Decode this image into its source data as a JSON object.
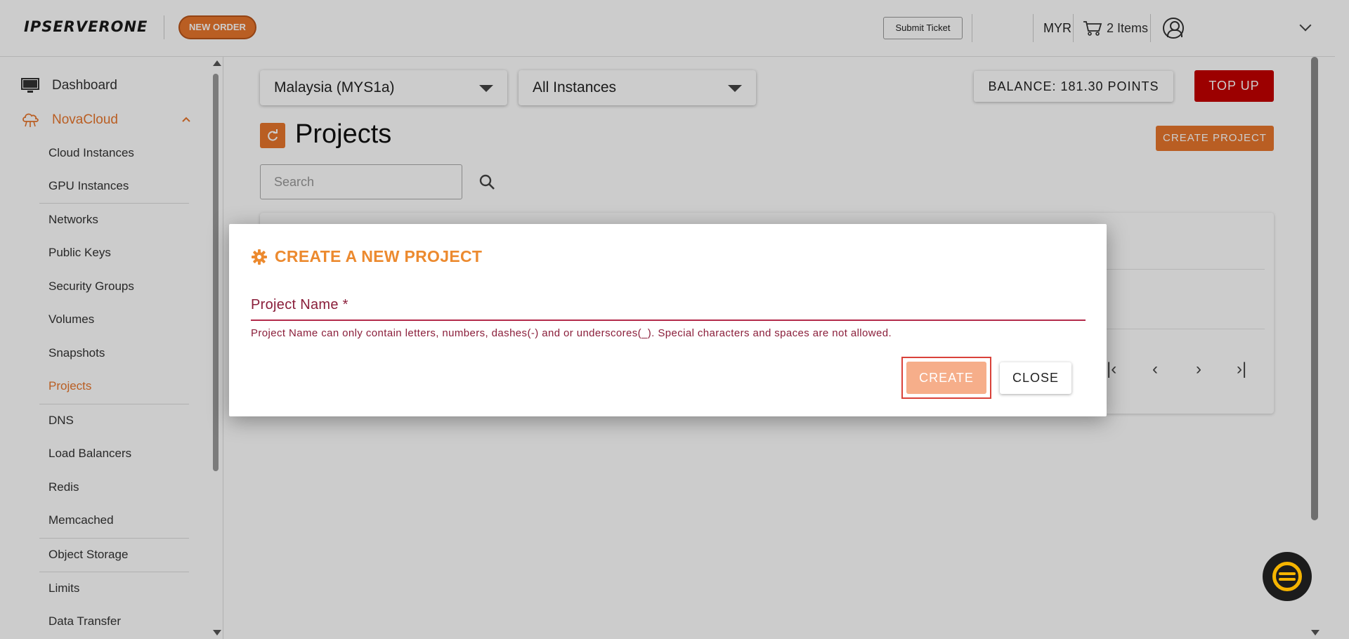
{
  "header": {
    "logo": "IPSERVERONE",
    "new_order": "NEW ORDER",
    "submit_ticket": "Submit Ticket",
    "currency": "MYR",
    "cart": "2 Items"
  },
  "sidebar": {
    "dashboard": "Dashboard",
    "novacloud": "NovaCloud",
    "items": [
      "Cloud Instances",
      "GPU Instances",
      "Networks",
      "Public Keys",
      "Security Groups",
      "Volumes",
      "Snapshots",
      "Projects",
      "DNS",
      "Load Balancers",
      "Redis",
      "Memcached",
      "Object Storage",
      "Limits",
      "Data Transfer"
    ],
    "active_item": "Projects"
  },
  "main": {
    "region_select": "Malaysia (MYS1a)",
    "instance_select": "All Instances",
    "balance": "BALANCE: 181.30 POINTS",
    "top_up": "TOP UP",
    "page_title": "Projects",
    "create_project": "CREATE PROJECT",
    "search_placeholder": "Search"
  },
  "modal": {
    "title": "CREATE A NEW PROJECT",
    "field_label": "Project Name *",
    "field_error": "Project Name can only contain letters, numbers, dashes(-) and or underscores(_). Special characters and spaces are not allowed.",
    "create": "CREATE",
    "close": "CLOSE"
  },
  "colors": {
    "accent": "#e8762c",
    "topup": "#c40000",
    "error": "#8a1e3a",
    "modal_title": "#ec8a2f"
  }
}
